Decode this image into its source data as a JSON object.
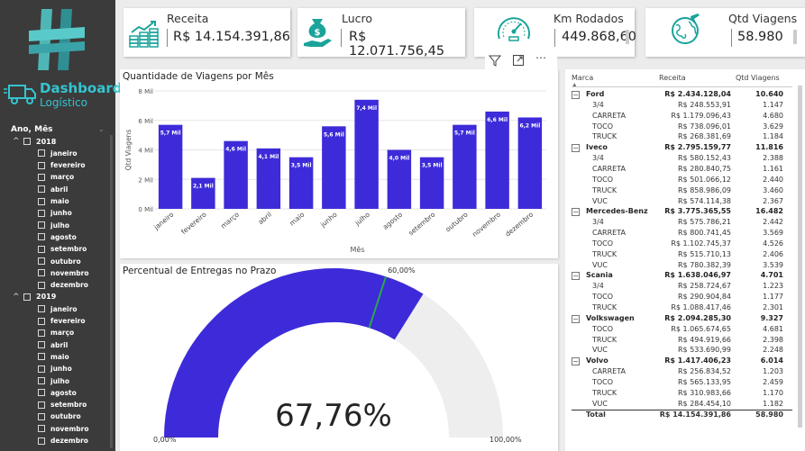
{
  "sidebar": {
    "title": "Dashboard",
    "subtitle": "Logístico",
    "filter_title": "Ano, Mês",
    "years": [
      {
        "year": "2018",
        "months": [
          "janeiro",
          "fevereiro",
          "março",
          "abril",
          "maio",
          "junho",
          "julho",
          "agosto",
          "setembro",
          "outubro",
          "novembro",
          "dezembro"
        ]
      },
      {
        "year": "2019",
        "months": [
          "janeiro",
          "fevereiro",
          "março",
          "abril",
          "maio",
          "junho",
          "julho",
          "agosto",
          "setembro",
          "outubro",
          "novembro",
          "dezembro"
        ]
      }
    ]
  },
  "kpis": {
    "receita": {
      "label": "Receita",
      "value": "R$ 14.154.391,86",
      "icon": "coins-chart-icon"
    },
    "lucro": {
      "label": "Lucro",
      "value": "R$ 12.071.756,45",
      "icon": "money-bag-hand-icon"
    },
    "km": {
      "label": "Km Rodados",
      "value": "449.868,60",
      "icon": "speedometer-icon"
    },
    "viagens": {
      "label": "Qtd Viagens",
      "value": "58.980",
      "icon": "globe-plane-icon"
    }
  },
  "colors": {
    "accent": "#3d2bd9",
    "teal": "#35c4d0",
    "sidebar": "#3b3b3b"
  },
  "bar_chart": {
    "title": "Quantidade de Viagens por Mês",
    "chart_data": {
      "type": "bar",
      "categories": [
        "janeiro",
        "fevereiro",
        "março",
        "abril",
        "maio",
        "junho",
        "julho",
        "agosto",
        "setembro",
        "outubro",
        "novembro",
        "dezembro"
      ],
      "values": [
        5.7,
        2.1,
        4.6,
        4.1,
        3.5,
        5.6,
        7.4,
        4.0,
        3.5,
        5.7,
        6.6,
        6.2
      ],
      "data_labels": [
        "5,7 Mil",
        "2,1 Mil",
        "4,6 Mil",
        "4,1 Mil",
        "3,5 Mil",
        "5,6 Mil",
        "7,4 Mil",
        "4,0 Mil",
        "3,5 Mil",
        "5,7 Mil",
        "6,6 Mil",
        "6,2 Mil"
      ],
      "ylabel": "Qtd Viagens",
      "xlabel": "Mês",
      "yticks": [
        "0 Mil",
        "2 Mil",
        "4 Mil",
        "6 Mil",
        "8 Mil"
      ],
      "ylim": [
        0,
        8
      ]
    }
  },
  "gauge": {
    "title": "Percentual de Entregas no Prazo",
    "value_label": "67,76%",
    "value": 67.76,
    "target": 60,
    "target_label": "60,00%",
    "min_label": "0,00%",
    "max_label": "100,00%"
  },
  "matrix": {
    "headers": [
      "Marca",
      "Receita",
      "Qtd Viagens"
    ],
    "rows": [
      {
        "type": "brand",
        "name": "Ford",
        "receita": "R$ 2.434.128,04",
        "qtd": "10.640"
      },
      {
        "type": "sub",
        "name": "3/4",
        "receita": "R$ 248.553,91",
        "qtd": "1.147"
      },
      {
        "type": "sub",
        "name": "CARRETA",
        "receita": "R$ 1.179.096,43",
        "qtd": "4.680"
      },
      {
        "type": "sub",
        "name": "TOCO",
        "receita": "R$ 738.096,01",
        "qtd": "3.629"
      },
      {
        "type": "sub",
        "name": "TRUCK",
        "receita": "R$ 268.381,69",
        "qtd": "1.184"
      },
      {
        "type": "brand",
        "name": "Iveco",
        "receita": "R$ 2.795.159,77",
        "qtd": "11.816"
      },
      {
        "type": "sub",
        "name": "3/4",
        "receita": "R$ 580.152,43",
        "qtd": "2.388"
      },
      {
        "type": "sub",
        "name": "CARRETA",
        "receita": "R$ 280.840,75",
        "qtd": "1.161"
      },
      {
        "type": "sub",
        "name": "TOCO",
        "receita": "R$ 501.066,12",
        "qtd": "2.440"
      },
      {
        "type": "sub",
        "name": "TRUCK",
        "receita": "R$ 858.986,09",
        "qtd": "3.460"
      },
      {
        "type": "sub",
        "name": "VUC",
        "receita": "R$ 574.114,38",
        "qtd": "2.367"
      },
      {
        "type": "brand",
        "name": "Mercedes-Benz",
        "receita": "R$ 3.775.365,55",
        "qtd": "16.482"
      },
      {
        "type": "sub",
        "name": "3/4",
        "receita": "R$ 575.786,21",
        "qtd": "2.442"
      },
      {
        "type": "sub",
        "name": "CARRETA",
        "receita": "R$ 800.741,45",
        "qtd": "3.569"
      },
      {
        "type": "sub",
        "name": "TOCO",
        "receita": "R$ 1.102.745,37",
        "qtd": "4.526"
      },
      {
        "type": "sub",
        "name": "TRUCK",
        "receita": "R$ 515.710,13",
        "qtd": "2.406"
      },
      {
        "type": "sub",
        "name": "VUC",
        "receita": "R$ 780.382,39",
        "qtd": "3.539"
      },
      {
        "type": "brand",
        "name": "Scania",
        "receita": "R$ 1.638.046,97",
        "qtd": "4.701"
      },
      {
        "type": "sub",
        "name": "3/4",
        "receita": "R$ 258.724,67",
        "qtd": "1.223"
      },
      {
        "type": "sub",
        "name": "TOCO",
        "receita": "R$ 290.904,84",
        "qtd": "1.177"
      },
      {
        "type": "sub",
        "name": "TRUCK",
        "receita": "R$ 1.088.417,46",
        "qtd": "2.301"
      },
      {
        "type": "brand",
        "name": "Volkswagen",
        "receita": "R$ 2.094.285,30",
        "qtd": "9.327"
      },
      {
        "type": "sub",
        "name": "TOCO",
        "receita": "R$ 1.065.674,65",
        "qtd": "4.681"
      },
      {
        "type": "sub",
        "name": "TRUCK",
        "receita": "R$ 494.919,66",
        "qtd": "2.398"
      },
      {
        "type": "sub",
        "name": "VUC",
        "receita": "R$ 533.690,99",
        "qtd": "2.248"
      },
      {
        "type": "brand",
        "name": "Volvo",
        "receita": "R$ 1.417.406,23",
        "qtd": "6.014"
      },
      {
        "type": "sub",
        "name": "CARRETA",
        "receita": "R$ 256.834,52",
        "qtd": "1.203"
      },
      {
        "type": "sub",
        "name": "TOCO",
        "receita": "R$ 565.133,95",
        "qtd": "2.459"
      },
      {
        "type": "sub",
        "name": "TRUCK",
        "receita": "R$ 310.983,66",
        "qtd": "1.170"
      },
      {
        "type": "sub",
        "name": "VUC",
        "receita": "R$ 284.454,10",
        "qtd": "1.182"
      },
      {
        "type": "total",
        "name": "Total",
        "receita": "R$ 14.154.391,86",
        "qtd": "58.980"
      }
    ]
  },
  "visual_header_icons": [
    "filter-icon",
    "focus-mode-icon",
    "more-options-icon"
  ]
}
